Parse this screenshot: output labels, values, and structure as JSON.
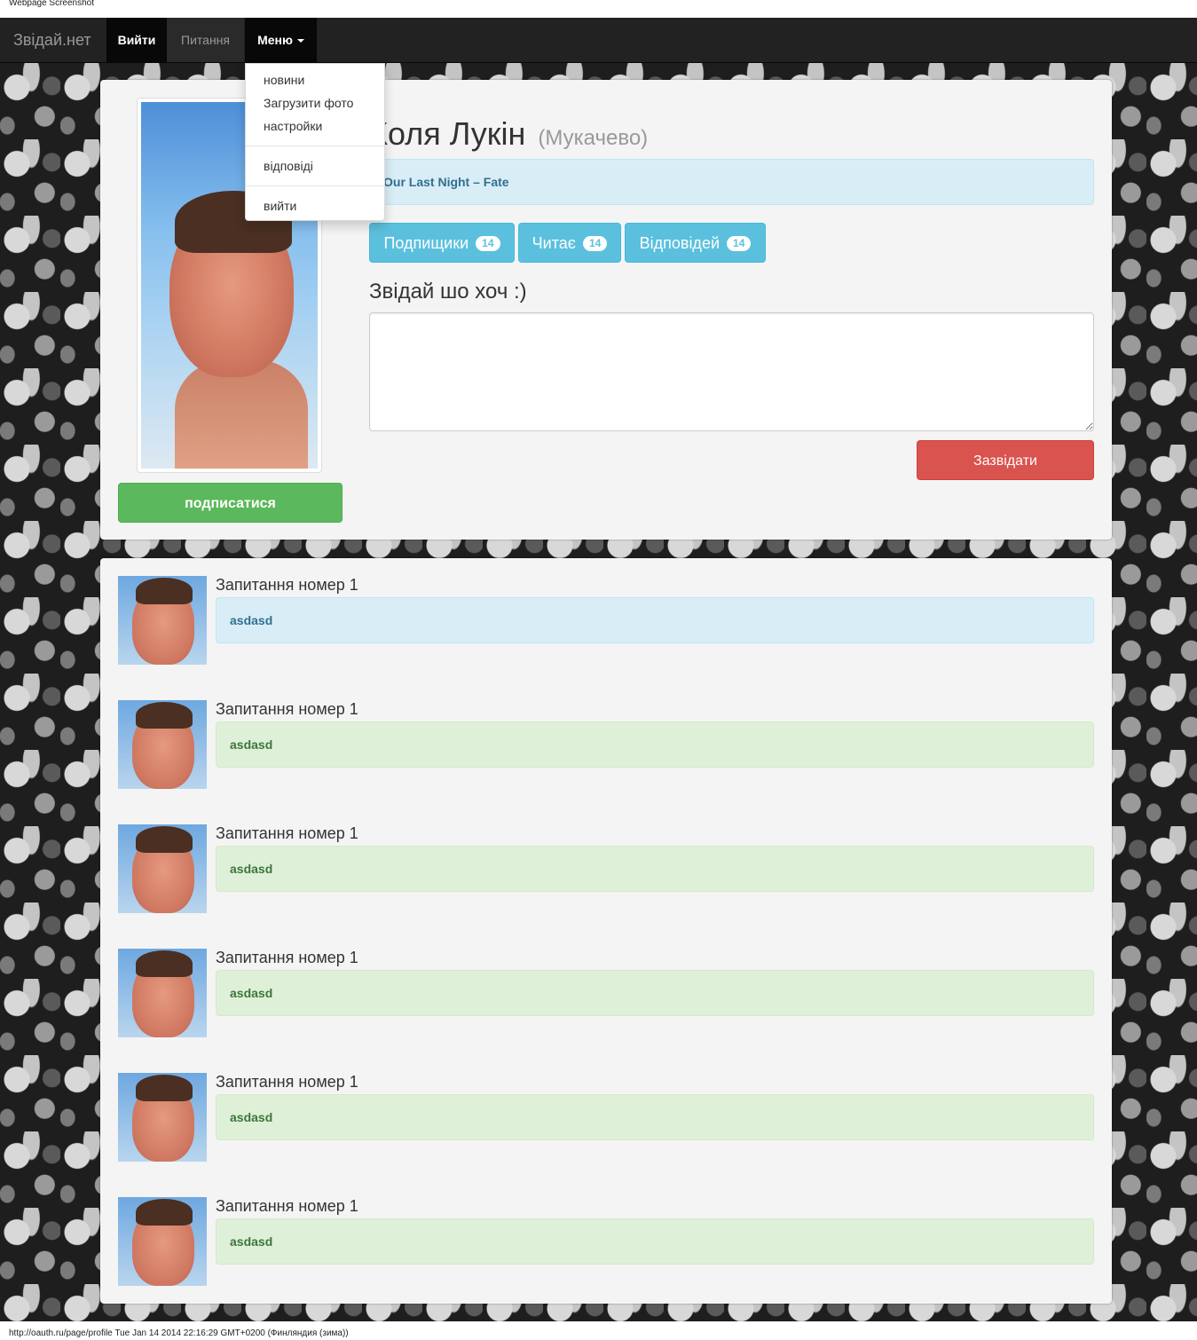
{
  "captions": {
    "top": "Webpage Screenshot",
    "bottom": "http://oauth.ru/page/profile Tue Jan 14 2014 22:16:29 GMT+0200 (Финляндия (зима))"
  },
  "navbar": {
    "brand": "Звідай.нет",
    "login": "Вийти",
    "questions": "Питання",
    "menu": "Меню"
  },
  "dropdown": {
    "items": [
      "новини",
      "Загрузити фото",
      "настройки",
      "відповіді",
      "вийти"
    ]
  },
  "profile": {
    "name": "Коля Лукін",
    "city": "(Мукачево)",
    "status": "Our Last Night – Fate",
    "subscribe_label": "подписатися",
    "stats": [
      {
        "label": "Подпищики",
        "count": "14"
      },
      {
        "label": "Читає",
        "count": "14"
      },
      {
        "label": "Відповідей",
        "count": "14"
      }
    ],
    "ask_heading": "Звідай шо хоч :)",
    "ask_button": "Зазвідати",
    "ask_value": ""
  },
  "colors": {
    "navbar": "#222222",
    "info": "#5bc0de",
    "success": "#5cb85c",
    "danger": "#d9534f"
  },
  "questions": [
    {
      "title": "Запитання номер 1",
      "answer": "asdasd",
      "style": "info"
    },
    {
      "title": "Запитання номер 1",
      "answer": "asdasd",
      "style": "success"
    },
    {
      "title": "Запитання номер 1",
      "answer": "asdasd",
      "style": "success"
    },
    {
      "title": "Запитання номер 1",
      "answer": "asdasd",
      "style": "success"
    },
    {
      "title": "Запитання номер 1",
      "answer": "asdasd",
      "style": "success"
    },
    {
      "title": "Запитання номер 1",
      "answer": "asdasd",
      "style": "success"
    }
  ]
}
